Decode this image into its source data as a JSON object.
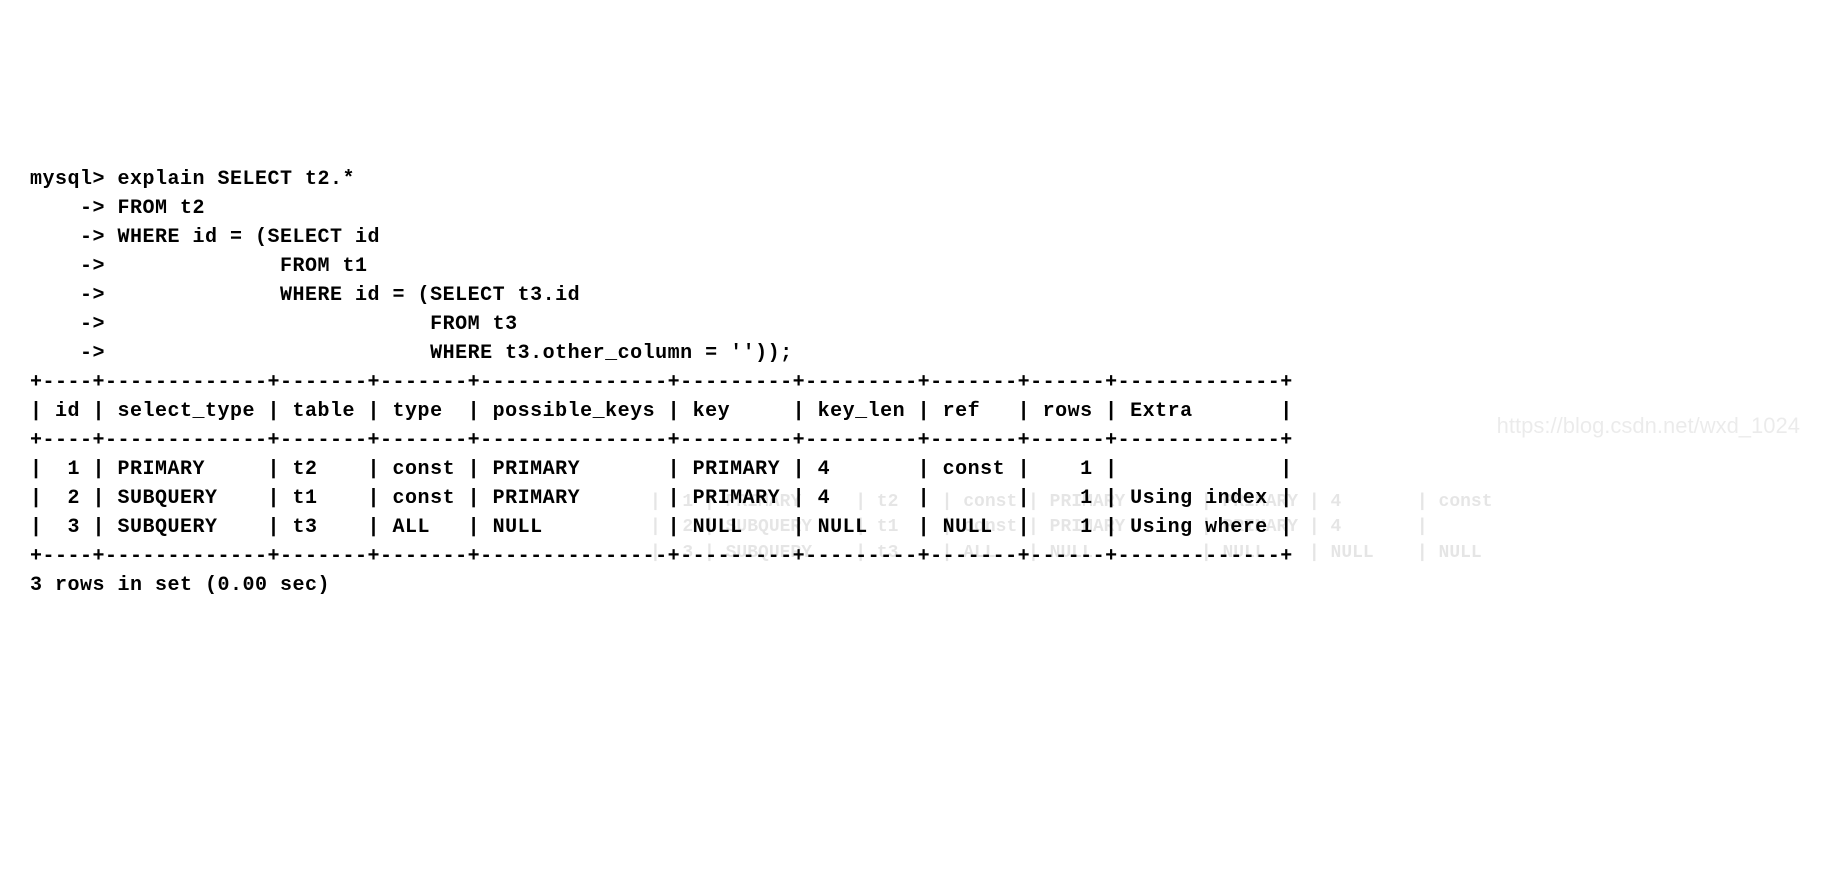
{
  "prompt": "mysql>",
  "cont": "    ->",
  "query_lines": [
    "mysql> explain SELECT t2.*",
    "    -> FROM t2",
    "    -> WHERE id = (SELECT id",
    "    ->              FROM t1",
    "    ->              WHERE id = (SELECT t3.id",
    "    ->                          FROM t3",
    "    ->                          WHERE t3.other_column = ''));"
  ],
  "border": "+----+-------------+-------+-------+---------------+---------+---------+-------+------+-------------+",
  "header": "| id | select_type | table | type  | possible_keys | key     | key_len | ref   | rows | Extra       |",
  "rows": [
    "|  1 | PRIMARY     | t2    | const | PRIMARY       | PRIMARY | 4       | const |    1 |             |",
    "|  2 | SUBQUERY    | t1    | const | PRIMARY       | PRIMARY | 4       |       |    1 | Using index |",
    "|  3 | SUBQUERY    | t3    | ALL   | NULL          | NULL    | NULL    | NULL  |    1 | Using where |"
  ],
  "footer": "3 rows in set (0.00 sec)",
  "chart_data": {
    "type": "table",
    "columns": [
      "id",
      "select_type",
      "table",
      "type",
      "possible_keys",
      "key",
      "key_len",
      "ref",
      "rows",
      "Extra"
    ],
    "data": [
      {
        "id": 1,
        "select_type": "PRIMARY",
        "table": "t2",
        "type": "const",
        "possible_keys": "PRIMARY",
        "key": "PRIMARY",
        "key_len": "4",
        "ref": "const",
        "rows": 1,
        "Extra": ""
      },
      {
        "id": 2,
        "select_type": "SUBQUERY",
        "table": "t1",
        "type": "const",
        "possible_keys": "PRIMARY",
        "key": "PRIMARY",
        "key_len": "4",
        "ref": "",
        "rows": 1,
        "Extra": "Using index"
      },
      {
        "id": 3,
        "select_type": "SUBQUERY",
        "table": "t3",
        "type": "ALL",
        "possible_keys": "NULL",
        "key": "NULL",
        "key_len": "NULL",
        "ref": "NULL",
        "rows": 1,
        "Extra": "Using where"
      }
    ]
  },
  "watermark": "https://blog.csdn.net/wxd_1024",
  "ghost_rows": [
    "|  1 | PRIMARY     | t2    | const | PRIMARY       | PRIMARY | 4       | const",
    "|  2 | SUBQUERY    | t1    | const | PRIMARY       | PRIMARY | 4       |",
    "|  3 | SUBQUERY    | t3    | ALL   | NULL          | NULL    | NULL    | NULL"
  ]
}
